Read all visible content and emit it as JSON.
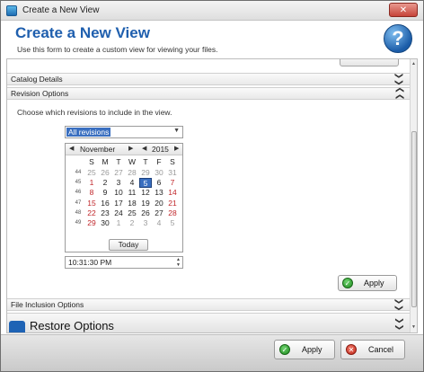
{
  "window": {
    "title": "Create a New View",
    "close_label": "✕"
  },
  "header": {
    "title": "Create a New View",
    "subtitle": "Use this form to create a custom view for viewing your files.",
    "help_glyph": "?"
  },
  "sections": {
    "catalog_details": "Catalog Details",
    "revision_options": "Revision Options",
    "file_inclusion": "File Inclusion Options",
    "restore": "Restore Options",
    "chevron": "❯❯"
  },
  "revision": {
    "instructions": "Choose which revisions to include in the view.",
    "selected": "All revisions"
  },
  "calendar": {
    "month": "November",
    "year": "2015",
    "weekdays": [
      "S",
      "M",
      "T",
      "W",
      "T",
      "F",
      "S"
    ],
    "weeks": [
      "44",
      "45",
      "46",
      "47",
      "48",
      "49"
    ],
    "days": [
      [
        "25",
        "26",
        "27",
        "28",
        "29",
        "30",
        "31"
      ],
      [
        "1",
        "2",
        "3",
        "4",
        "5",
        "6",
        "7"
      ],
      [
        "8",
        "9",
        "10",
        "11",
        "12",
        "13",
        "14"
      ],
      [
        "15",
        "16",
        "17",
        "18",
        "19",
        "20",
        "21"
      ],
      [
        "22",
        "23",
        "24",
        "25",
        "26",
        "27",
        "28"
      ],
      [
        "29",
        "30",
        "1",
        "2",
        "3",
        "4",
        "5"
      ]
    ],
    "selected_day": "5",
    "today_label": "Today"
  },
  "time": {
    "value": "10:31:30 PM"
  },
  "buttons": {
    "apply_inner": "Apply",
    "apply": "Apply",
    "cancel": "Cancel"
  },
  "colors": {
    "accent": "#1f5fae",
    "selection": "#3a6fc0",
    "weekend": "#c0262a"
  }
}
